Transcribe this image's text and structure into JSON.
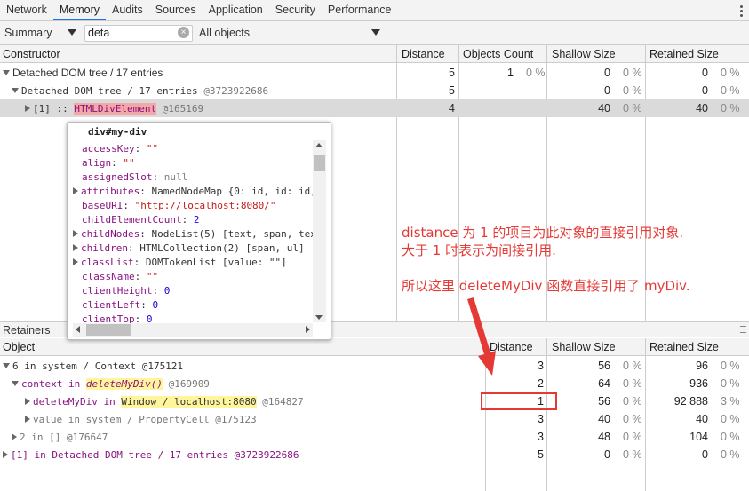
{
  "tabs": [
    "Network",
    "Memory",
    "Audits",
    "Sources",
    "Application",
    "Security",
    "Performance"
  ],
  "active_tab": "Memory",
  "toolbar": {
    "view": "Summary",
    "filter_value": "deta",
    "class_filter": "All objects"
  },
  "constructor_table": {
    "headers": [
      "Constructor",
      "Distance",
      "Objects Count",
      "Shallow Size",
      "Retained Size"
    ],
    "rows": [
      {
        "name": "Detached DOM tree / 17 entries",
        "distance": "5",
        "count": "1",
        "count_pct": "0 %",
        "shallow": "0",
        "shallow_pct": "0 %",
        "retained": "0",
        "retained_pct": "0 %"
      },
      {
        "name": "Detached DOM tree / 17 entries",
        "id": "@3723922686",
        "distance": "5",
        "shallow": "0",
        "shallow_pct": "0 %",
        "retained": "0",
        "retained_pct": "0 %"
      },
      {
        "prefix": "[1] :: ",
        "name": "HTMLDivElement",
        "id": "@165169",
        "distance": "4",
        "shallow": "40",
        "shallow_pct": "0 %",
        "retained": "40",
        "retained_pct": "0 %"
      }
    ]
  },
  "popover": {
    "title": "div#my-div",
    "lines": [
      {
        "key": "accessKey",
        "value": "\"\""
      },
      {
        "key": "align",
        "value": "\"\""
      },
      {
        "key": "assignedSlot",
        "value": "null"
      },
      {
        "key": "attributes",
        "value": "NamedNodeMap {0: id, id: id,",
        "expandable": true
      },
      {
        "key": "baseURI",
        "value": "\"http://localhost:8080/\""
      },
      {
        "key": "childElementCount",
        "value": "2"
      },
      {
        "key": "childNodes",
        "value": "NodeList(5) [text, span, tex",
        "expandable": true
      },
      {
        "key": "children",
        "value": "HTMLCollection(2) [span, ul]",
        "expandable": true
      },
      {
        "key": "classList",
        "value": "DOMTokenList [value: \"\"]",
        "expandable": true
      },
      {
        "key": "className",
        "value": "\"\""
      },
      {
        "key": "clientHeight",
        "value": "0"
      },
      {
        "key": "clientLeft",
        "value": "0"
      },
      {
        "key": "clientTop",
        "value": "0"
      }
    ]
  },
  "annotation": {
    "line1": "distance 为 1 的项目为此对象的直接引用对象.",
    "line2": "大于 1 时表示为间接引用.",
    "line3": "所以这里 deleteMyDiv 函数直接引用了 myDiv."
  },
  "retainers": {
    "title": "Retainers",
    "headers": [
      "Object",
      "Distance",
      "Shallow Size",
      "Retained Size"
    ],
    "rows": [
      {
        "text": "6 in system / Context @175121",
        "distance": "3",
        "shallow": "56",
        "shallow_pct": "0 %",
        "retained": "96",
        "retained_pct": "0 %"
      },
      {
        "pre": "context in ",
        "fn": "deleteMyDiv()",
        "post": " @169909",
        "distance": "2",
        "shallow": "64",
        "shallow_pct": "0 %",
        "retained": "936",
        "retained_pct": "0 %"
      },
      {
        "pre": "deleteMyDiv in ",
        "win": "Window / localhost:8080",
        "post": " @164827",
        "distance": "1",
        "shallow": "56",
        "shallow_pct": "0 %",
        "retained": "92 888",
        "retained_pct": "3 %"
      },
      {
        "pre": "value in system / PropertyCell @175123",
        "distance": "3",
        "shallow": "40",
        "shallow_pct": "0 %",
        "retained": "40",
        "retained_pct": "0 %"
      },
      {
        "pre": "2 in [] @176647",
        "distance": "3",
        "shallow": "48",
        "shallow_pct": "0 %",
        "retained": "104",
        "retained_pct": "0 %"
      },
      {
        "pre": "[1] in Detached DOM tree / 17 entries @3723922686",
        "distance": "5",
        "shallow": "0",
        "shallow_pct": "0 %",
        "retained": "0",
        "retained_pct": "0 %"
      }
    ]
  }
}
